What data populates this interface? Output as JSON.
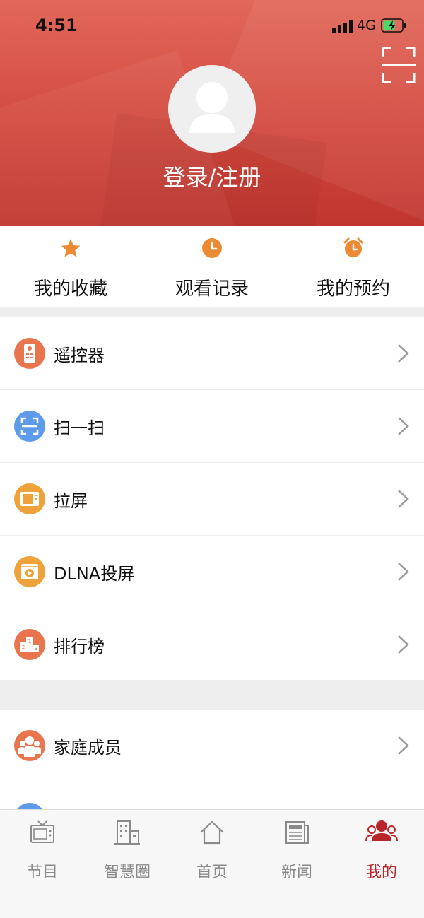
{
  "status_bar": {
    "time": "4:51",
    "network": "4G"
  },
  "profile": {
    "login_label": "登录/注册"
  },
  "quick_actions": [
    {
      "label": "我的收藏",
      "icon": "star-icon"
    },
    {
      "label": "观看记录",
      "icon": "clock-icon"
    },
    {
      "label": "我的预约",
      "icon": "alarm-icon"
    }
  ],
  "menu_group1": [
    {
      "label": "遥控器",
      "icon": "remote-control-icon",
      "color": "#e8754d"
    },
    {
      "label": "扫一扫",
      "icon": "scan-icon",
      "color": "#5b9bea"
    },
    {
      "label": "拉屏",
      "icon": "pull-screen-icon",
      "color": "#f0a23a"
    },
    {
      "label": "DLNA投屏",
      "icon": "dlna-cast-icon",
      "color": "#f0a23a"
    },
    {
      "label": "排行榜",
      "icon": "podium-icon",
      "color": "#e8754d"
    }
  ],
  "menu_group2": [
    {
      "label": "家庭成员",
      "icon": "family-icon",
      "color": "#e8754d"
    }
  ],
  "tabbar": [
    {
      "label": "节目",
      "icon": "tv-icon",
      "active": false
    },
    {
      "label": "智慧圈",
      "icon": "building-icon",
      "active": false
    },
    {
      "label": "首页",
      "icon": "home-icon",
      "active": false
    },
    {
      "label": "新闻",
      "icon": "news-icon",
      "active": false
    },
    {
      "label": "我的",
      "icon": "people-icon",
      "active": true
    }
  ],
  "colors": {
    "brand_red": "#d3493f",
    "active_tab": "#b8262a",
    "separator": "#eeeeee"
  }
}
